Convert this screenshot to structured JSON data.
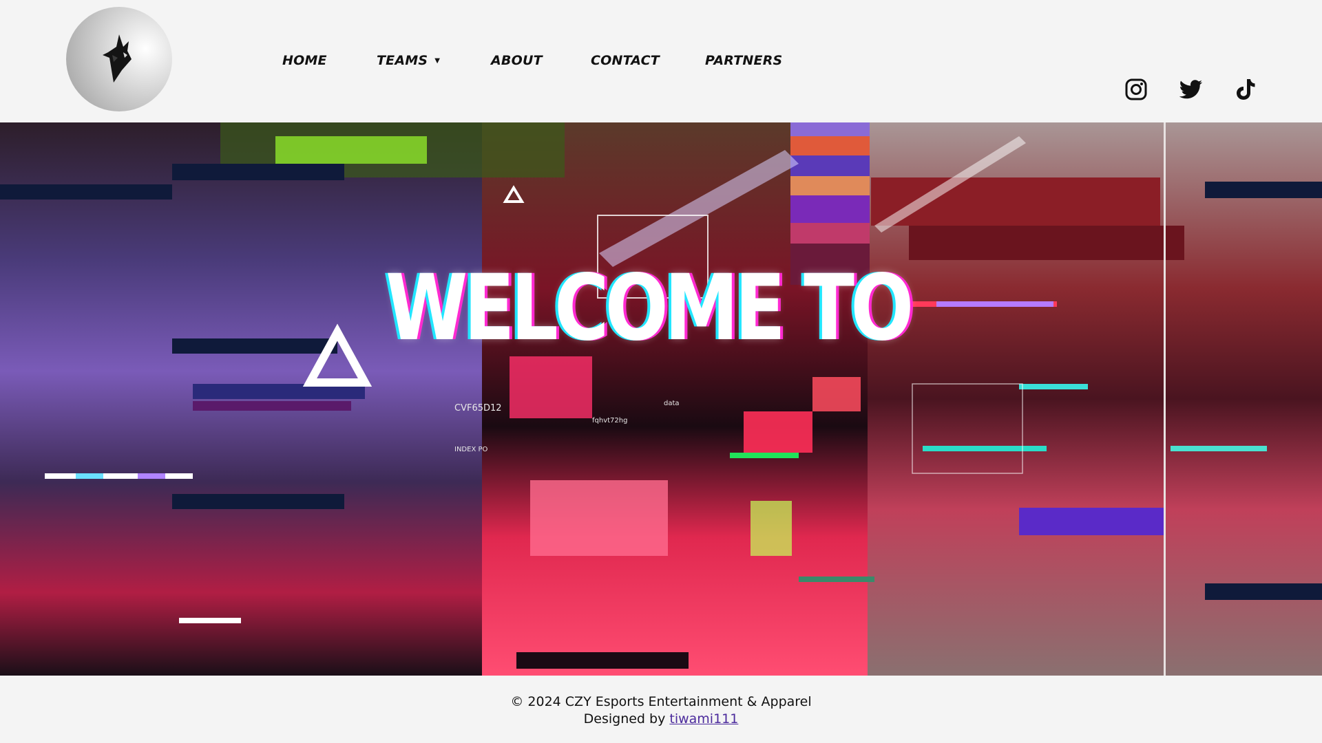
{
  "nav": {
    "home": "HOME",
    "teams": "TEAMS",
    "about": "ABOUT",
    "contact": "CONTACT",
    "partners": "PARTNERS"
  },
  "icons": {
    "logo": "fox-logo-icon",
    "teams_dropdown": "caret-down-icon",
    "instagram": "instagram-icon",
    "twitter": "twitter-icon",
    "tiktok": "tiktok-icon"
  },
  "hero": {
    "headline": "WELCOME TO",
    "overlay_texts": [
      "CVF65D12",
      "data",
      "fqhvt72hg",
      "INDEX PO"
    ]
  },
  "footer": {
    "copyright": "© 2024 CZY Esports Entertainment & Apparel",
    "designed_by_prefix": "Designed by ",
    "designer_link": "tiwami111"
  },
  "colors": {
    "background": "#f4f4f4",
    "text": "#111111",
    "link": "#4b2a9c",
    "glitch_cyan": "#22e6ff",
    "glitch_magenta": "#ff2ad1"
  }
}
